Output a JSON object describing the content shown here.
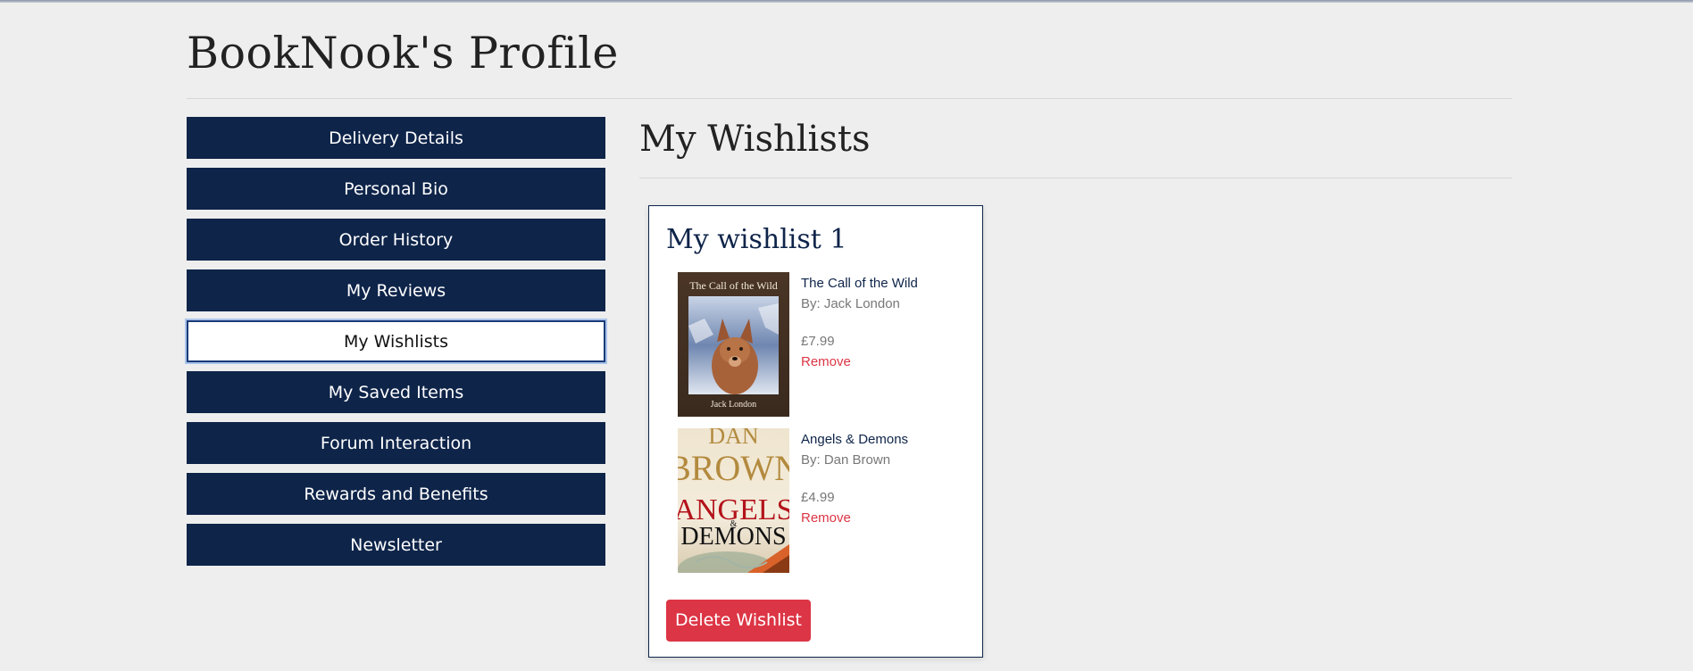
{
  "profile": {
    "title": "BookNook's Profile"
  },
  "sidebar": {
    "items": [
      {
        "label": "Delivery Details"
      },
      {
        "label": "Personal Bio"
      },
      {
        "label": "Order History"
      },
      {
        "label": "My Reviews"
      },
      {
        "label": "My Wishlists",
        "active": true
      },
      {
        "label": "My Saved Items"
      },
      {
        "label": "Forum Interaction"
      },
      {
        "label": "Rewards and Benefits"
      },
      {
        "label": "Newsletter"
      }
    ]
  },
  "main": {
    "section_title": "My Wishlists",
    "wishlist": {
      "name": "My wishlist 1",
      "books": [
        {
          "title": "The Call of the Wild",
          "author": "By: Jack London",
          "price": "£7.99",
          "remove_label": "Remove",
          "cover": {
            "title_text": "The Call of the Wild",
            "author_text": "Jack London"
          }
        },
        {
          "title": "Angels & Demons",
          "author": "By: Dan Brown",
          "price": "£4.99",
          "remove_label": "Remove",
          "cover": {
            "author_line1": "DAN",
            "author_line2": "BROWN",
            "title_line1": "ANGELS",
            "title_amp": "&",
            "title_line2": "DEMONS"
          }
        }
      ],
      "delete_label": "Delete Wishlist"
    }
  },
  "colors": {
    "primary": "#0e2449",
    "danger": "#dc3545",
    "background": "#eeeeee"
  }
}
